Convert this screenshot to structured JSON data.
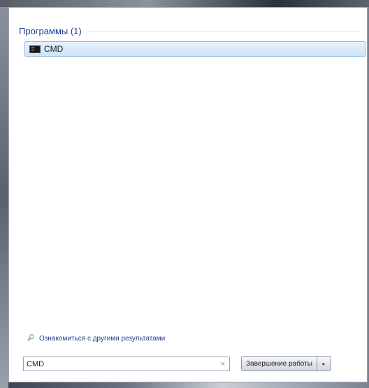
{
  "start_menu": {
    "group": {
      "title": "Программы (1)",
      "items": [
        {
          "label": "CMD",
          "icon": "cmd-icon"
        }
      ]
    },
    "more_results": {
      "label": "Ознакомиться с другими результатами",
      "icon": "search-icon"
    },
    "search": {
      "value": "CMD",
      "clear_glyph": "×"
    },
    "shutdown": {
      "label": "Завершение работы",
      "arrow_glyph": "▸"
    }
  },
  "colors": {
    "accent_text": "#1e3f8f",
    "selection_fill": "#cfe4f8",
    "selection_border": "#8fb8e3"
  }
}
